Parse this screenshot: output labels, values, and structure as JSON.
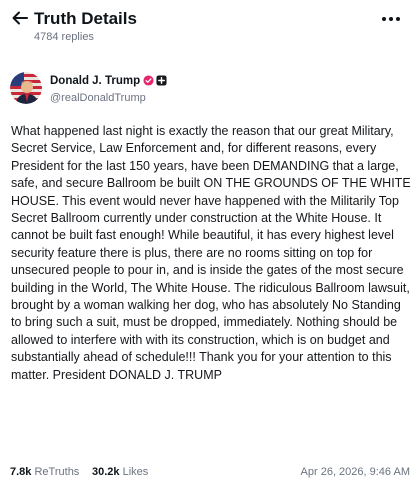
{
  "header": {
    "title": "Truth Details",
    "replies": "4784 replies",
    "back_icon": "arrow-left-icon",
    "more_icon": "more-horizontal-icon"
  },
  "author": {
    "name": "Donald J. Trump",
    "handle": "@realDonaldTrump",
    "verified_icon": "verified-badge-icon",
    "verified_color": "#e5286e",
    "plus_icon": "plus-badge-icon"
  },
  "post": {
    "text": "What happened last night is exactly the reason that our great Military, Secret Service, Law Enforcement and, for different reasons, every President for the last 150 years, have been DEMANDING that a large, safe, and secure Ballroom be built ON THE GROUNDS OF THE WHITE HOUSE. This event would never have happened with the Militarily Top Secret Ballroom currently under construction at the White House. It cannot be built fast enough! While beautiful, it has every highest level security feature there is plus, there are no rooms sitting on top for unsecured people to pour in, and is inside the gates of the most secure building in the World, The White House. The ridiculous Ballroom lawsuit, brought by a woman walking her dog, who has absolutely No Standing to bring such a suit, must be dropped, immediately. Nothing should be allowed to interfere with with its construction, which is on budget and substantially ahead of schedule!!! Thank you for your attention to this matter. President DONALD J. TRUMP"
  },
  "footer": {
    "retruths_count": "7.8k",
    "retruths_label": "ReTruths",
    "likes_count": "30.2k",
    "likes_label": "Likes",
    "timestamp": "Apr 26, 2026, 9:46 AM"
  }
}
